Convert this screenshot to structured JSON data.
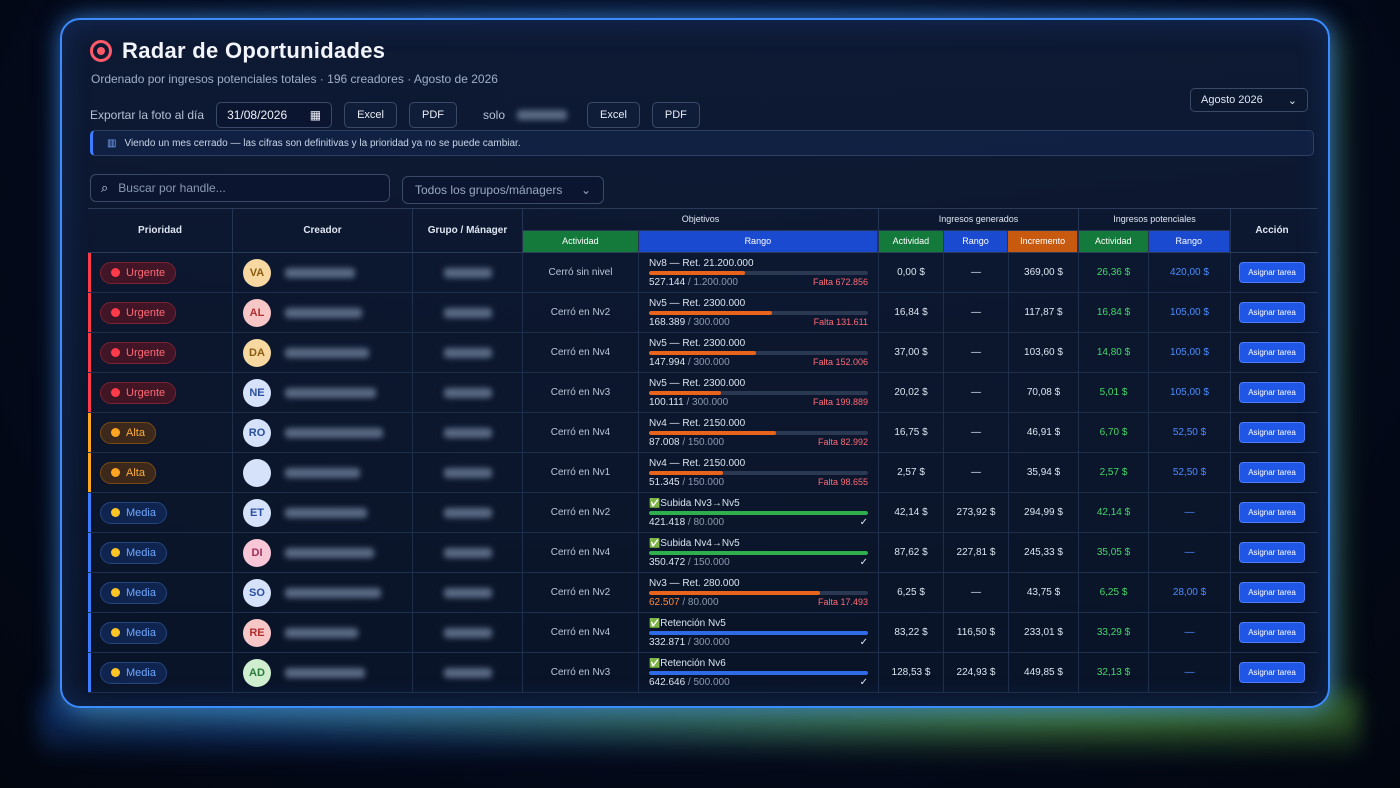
{
  "header": {
    "title": "Radar de Oportunidades",
    "subtitle": "Ordenado por ingresos potenciales totales · 196 creadores · Agosto de 2026",
    "month_select": "Agosto 2026"
  },
  "toolbar": {
    "export_label": "Exportar la foto al día",
    "date_value": "31/08/2026",
    "excel_label": "Excel",
    "pdf_label": "PDF",
    "solo_label": "solo",
    "excel2_label": "Excel",
    "pdf2_label": "PDF"
  },
  "notice": "Viendo un mes cerrado — las cifras son definitivas y la prioridad ya no se puede cambiar.",
  "search": {
    "placeholder": "Buscar por handle..."
  },
  "group_filter": "Todos los grupos/mánagers",
  "columns": {
    "prioridad": "Prioridad",
    "creador": "Creador",
    "grupo": "Grupo / Mánager",
    "objetivos": "Objetivos",
    "obj_actividad": "Actividad",
    "obj_rango": "Rango",
    "ing_gen": "Ingresos generados",
    "ig_actividad": "Actividad",
    "ig_rango": "Rango",
    "ig_incremento": "Incremento",
    "ing_pot": "Ingresos potenciales",
    "ip_actividad": "Actividad",
    "ip_rango": "Rango",
    "accion": "Acción"
  },
  "colors": {
    "urgent": "#ff3b4a",
    "alta": "#ffa520",
    "media": "#3d7bff",
    "accent": "#1f56e6"
  },
  "rows": [
    {
      "prio": "Urgente",
      "level": "urgent",
      "initials": "VA",
      "avatar_bg": "#f6d8a0",
      "avatar_fg": "#8a5a10",
      "actividad": "Cerró sin nivel",
      "rank_title": "Nv8 — Ret. 21.200.000",
      "rank_progress": "527.144",
      "rank_target": "/ 1.200.000",
      "falta": "Falta 672.856",
      "pct": 0.44,
      "bar": "#e8641c",
      "done": false,
      "ig_act": "0,00 $",
      "ig_rango": "—",
      "ig_inc": "369,00 $",
      "ip_act": "26,36 $",
      "ip_rango": "420,00 $",
      "action": "Asignar tarea"
    },
    {
      "prio": "Urgente",
      "level": "urgent",
      "initials": "AL",
      "avatar_bg": "#f7c7c7",
      "avatar_fg": "#b03030",
      "actividad": "Cerró en Nv2",
      "rank_title": "Nv5 — Ret. 2300.000",
      "rank_progress": "168.389",
      "rank_target": "/ 300.000",
      "falta": "Falta 131.611",
      "pct": 0.56,
      "bar": "#e8641c",
      "done": false,
      "ig_act": "16,84 $",
      "ig_rango": "—",
      "ig_inc": "117,87 $",
      "ip_act": "16,84 $",
      "ip_rango": "105,00 $",
      "action": "Asignar tarea"
    },
    {
      "prio": "Urgente",
      "level": "urgent",
      "initials": "DA",
      "avatar_bg": "#f6d8a0",
      "avatar_fg": "#8a5a10",
      "actividad": "Cerró en Nv4",
      "rank_title": "Nv5 — Ret. 2300.000",
      "rank_progress": "147.994",
      "rank_target": "/ 300.000",
      "falta": "Falta 152.006",
      "pct": 0.49,
      "bar": "#e8641c",
      "done": false,
      "ig_act": "37,00 $",
      "ig_rango": "—",
      "ig_inc": "103,60 $",
      "ip_act": "14,80 $",
      "ip_rango": "105,00 $",
      "action": "Asignar tarea"
    },
    {
      "prio": "Urgente",
      "level": "urgent",
      "initials": "NE",
      "avatar_bg": "#d6e2fa",
      "avatar_fg": "#2a4fa0",
      "actividad": "Cerró en Nv3",
      "rank_title": "Nv5 — Ret. 2300.000",
      "rank_progress": "100.111",
      "rank_target": "/ 300.000",
      "falta": "Falta 199.889",
      "pct": 0.33,
      "bar": "#e8641c",
      "done": false,
      "ig_act": "20,02 $",
      "ig_rango": "—",
      "ig_inc": "70,08 $",
      "ip_act": "5,01 $",
      "ip_rango": "105,00 $",
      "action": "Asignar tarea"
    },
    {
      "prio": "Alta",
      "level": "alta",
      "initials": "RO",
      "avatar_bg": "#d6e2fa",
      "avatar_fg": "#2a4fa0",
      "actividad": "Cerró en Nv4",
      "rank_title": "Nv4 — Ret. 2150.000",
      "rank_progress": "87.008",
      "rank_target": "/ 150.000",
      "falta": "Falta 82.992",
      "pct": 0.58,
      "bar": "#e8641c",
      "done": false,
      "ig_act": "16,75 $",
      "ig_rango": "—",
      "ig_inc": "46,91 $",
      "ip_act": "6,70 $",
      "ip_rango": "52,50 $",
      "action": "Asignar tarea"
    },
    {
      "prio": "Alta",
      "level": "alta",
      "initials": "",
      "avatar_bg": "#d6e2fa",
      "avatar_fg": "#2a4fa0",
      "actividad": "Cerró en Nv1",
      "rank_title": "Nv4 — Ret. 2150.000",
      "rank_progress": "51.345",
      "rank_target": "/ 150.000",
      "falta": "Falta 98.655",
      "pct": 0.34,
      "bar": "#e8641c",
      "done": false,
      "ig_act": "2,57 $",
      "ig_rango": "—",
      "ig_inc": "35,94 $",
      "ip_act": "2,57 $",
      "ip_rango": "52,50 $",
      "action": "Asignar tarea"
    },
    {
      "prio": "Media",
      "level": "media",
      "initials": "ET",
      "avatar_bg": "#d6e2fa",
      "avatar_fg": "#2a4fa0",
      "actividad": "Cerró en Nv2",
      "rank_title": "Subida Nv3→Nv5",
      "rank_progress": "421.418",
      "rank_target": "/ 80.000",
      "falta": "",
      "pct": 1,
      "bar": "#2fae4e",
      "done": true,
      "ig_act": "42,14 $",
      "ig_rango": "273,92 $",
      "ig_inc": "294,99 $",
      "ip_act": "42,14 $",
      "ip_rango": "—",
      "action": "Asignar tarea"
    },
    {
      "prio": "Media",
      "level": "media",
      "initials": "DI",
      "avatar_bg": "#f7c7d8",
      "avatar_fg": "#a0305a",
      "actividad": "Cerró en Nv4",
      "rank_title": "Subida Nv4→Nv5",
      "rank_progress": "350.472",
      "rank_target": "/ 150.000",
      "falta": "",
      "pct": 1,
      "bar": "#2fae4e",
      "done": true,
      "ig_act": "87,62 $",
      "ig_rango": "227,81 $",
      "ig_inc": "245,33 $",
      "ip_act": "35,05 $",
      "ip_rango": "—",
      "action": "Asignar tarea"
    },
    {
      "prio": "Media",
      "level": "media",
      "initials": "SO",
      "avatar_bg": "#d6e2fa",
      "avatar_fg": "#2a4fa0",
      "actividad": "Cerró en Nv2",
      "rank_title": "Nv3 — Ret. 280.000",
      "rank_progress": "62.507",
      "rank_target": "/ 80.000",
      "falta": "Falta 17.493",
      "pct": 0.78,
      "bar": "#e8641c",
      "done": false,
      "ig_act": "6,25 $",
      "ig_rango": "—",
      "ig_inc": "43,75 $",
      "ip_act": "6,25 $",
      "ip_rango": "28,00 $",
      "action": "Asignar tarea"
    },
    {
      "prio": "Media",
      "level": "media",
      "initials": "RE",
      "avatar_bg": "#f7c7c7",
      "avatar_fg": "#b03030",
      "actividad": "Cerró en Nv4",
      "rank_title": "Retención Nv5",
      "rank_progress": "332.871",
      "rank_target": "/ 300.000",
      "falta": "",
      "pct": 1,
      "bar": "#2f6ae8",
      "done": true,
      "ig_act": "83,22 $",
      "ig_rango": "116,50 $",
      "ig_inc": "233,01 $",
      "ip_act": "33,29 $",
      "ip_rango": "—",
      "action": "Asignar tarea"
    },
    {
      "prio": "Media",
      "level": "media",
      "initials": "AD",
      "avatar_bg": "#cfeecf",
      "avatar_fg": "#2a7a3a",
      "actividad": "Cerró en Nv3",
      "rank_title": "Retención Nv6",
      "rank_progress": "642.646",
      "rank_target": "/ 500.000",
      "falta": "",
      "pct": 1,
      "bar": "#2f6ae8",
      "done": true,
      "ig_act": "128,53 $",
      "ig_rango": "224,93 $",
      "ig_inc": "449,85 $",
      "ip_act": "32,13 $",
      "ip_rango": "—",
      "action": "Asignar tarea"
    }
  ]
}
